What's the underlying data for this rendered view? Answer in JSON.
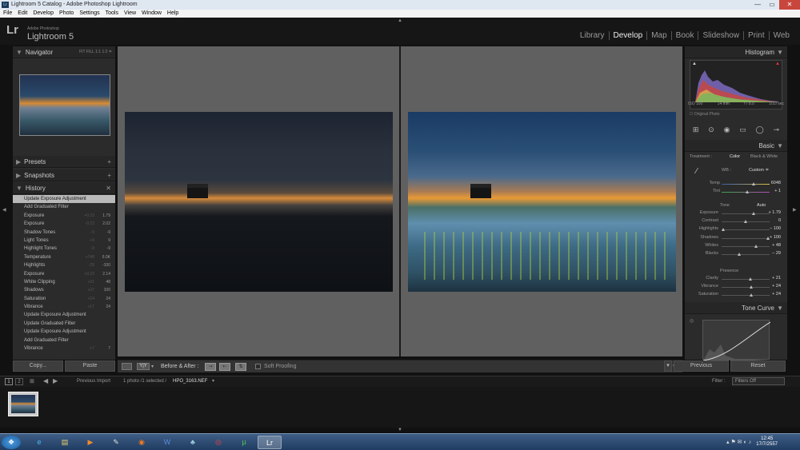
{
  "window": {
    "title": "Lightroom 5 Catalog - Adobe Photoshop Lightroom",
    "app_icon": "Lr",
    "controls": [
      "—",
      "▭",
      "✕"
    ]
  },
  "menu": [
    "File",
    "Edit",
    "Develop",
    "Photo",
    "Settings",
    "Tools",
    "View",
    "Window",
    "Help"
  ],
  "identity": {
    "logo": "Lr",
    "adobe": "Adobe Photoshop",
    "product": "Lightroom 5"
  },
  "modules": [
    "Library",
    "Develop",
    "Map",
    "Book",
    "Slideshow",
    "Print",
    "Web"
  ],
  "left_panel": {
    "navigator": {
      "title": "Navigator",
      "sizes": [
        "FIT",
        "FILL",
        "1:1",
        "1:2 ≑"
      ]
    },
    "presets": "Presets",
    "snapshots": "Snapshots",
    "history": {
      "title": "History",
      "items": [
        {
          "label": "Update Exposure Adjustment",
          "v1": "",
          "v2": ""
        },
        {
          "label": "Add Graduated Filter",
          "v1": "",
          "v2": ""
        },
        {
          "label": "Exposure",
          "v1": "+0.23",
          "v2": "1.79"
        },
        {
          "label": "Exposure",
          "v1": "-0.23",
          "v2": "2.02"
        },
        {
          "label": "Shadow Tones",
          "v1": "-9",
          "v2": "-9"
        },
        {
          "label": "Light Tones",
          "v1": "+9",
          "v2": "9"
        },
        {
          "label": "Highlight Tones",
          "v1": "-9",
          "v2": "-9"
        },
        {
          "label": "Temperature",
          "v1": "+748",
          "v2": "6.0K"
        },
        {
          "label": "Highlights",
          "v1": "-28",
          "v2": "-100"
        },
        {
          "label": "Exposure",
          "v1": "+0.23",
          "v2": "2.14"
        },
        {
          "label": "White Clipping",
          "v1": "+21",
          "v2": "48"
        },
        {
          "label": "Shadows",
          "v1": "+27",
          "v2": "100"
        },
        {
          "label": "Saturation",
          "v1": "+24",
          "v2": "24"
        },
        {
          "label": "Vibrance",
          "v1": "+17",
          "v2": "24"
        },
        {
          "label": "Update Exposure Adjustment",
          "v1": "",
          "v2": ""
        },
        {
          "label": "Update Graduated Filter",
          "v1": "",
          "v2": ""
        },
        {
          "label": "Update Exposure Adjustment",
          "v1": "",
          "v2": ""
        },
        {
          "label": "Add Graduated Filter",
          "v1": "",
          "v2": ""
        },
        {
          "label": "Vibrance",
          "v1": "+7",
          "v2": "7"
        }
      ]
    },
    "copy_label": "Copy...",
    "paste_label": "Paste"
  },
  "toolbar": {
    "yy": "Y|Y",
    "before_after": "Before & After :",
    "soft_proofing": "Soft Proofing"
  },
  "right_panel": {
    "histogram": {
      "title": "Histogram",
      "iso": "ISO 100",
      "focal": "14 mm",
      "aperture": "f / 8.0",
      "shutter": "1/10 sec",
      "original_photo": "Original Photo"
    },
    "basic": {
      "title": "Basic",
      "treatment_label": "Treatment :",
      "treatment_color": "Color",
      "treatment_bw": "Black & White",
      "wb_label": "WB :",
      "wb_value": "Custom ≑",
      "temp_label": "Temp",
      "temp_value": "6048",
      "tint_label": "Tint",
      "tint_value": "+ 1",
      "tone_label": "Tone",
      "auto_label": "Auto",
      "sliders": [
        {
          "label": "Exposure",
          "value": "+ 1.79",
          "level": 0.68
        },
        {
          "label": "Contrast",
          "value": "0",
          "level": 0.5
        },
        {
          "label": "Highlights",
          "value": "– 100",
          "level": 0.0
        },
        {
          "label": "Shadows",
          "value": "+ 100",
          "level": 1.0
        },
        {
          "label": "Whites",
          "value": "+ 48",
          "level": 0.74
        },
        {
          "label": "Blacks",
          "value": "– 29",
          "level": 0.36
        }
      ],
      "presence_label": "Presence",
      "presence": [
        {
          "label": "Clarity",
          "value": "+ 21",
          "level": 0.6
        },
        {
          "label": "Vibrance",
          "value": "+ 24",
          "level": 0.62
        },
        {
          "label": "Saturation",
          "value": "+ 24",
          "level": 0.62
        }
      ]
    },
    "tone_curve": "Tone Curve",
    "previous_label": "Previous",
    "reset_label": "Reset"
  },
  "filmstrip": {
    "page1": "1",
    "page2": "2",
    "source": "Previous Import",
    "count": "1 photo /1 selected /",
    "filename": "HPO_3163.NEF",
    "filter_label": "Filter :",
    "filter_value": "Filters Off"
  },
  "taskbar": {
    "time": "12:45",
    "date": "17/7/2557"
  },
  "colors": {
    "accent_selected": "#b9b9b9",
    "panel_bg": "#2b2b2b",
    "center_bg": "#606060"
  }
}
